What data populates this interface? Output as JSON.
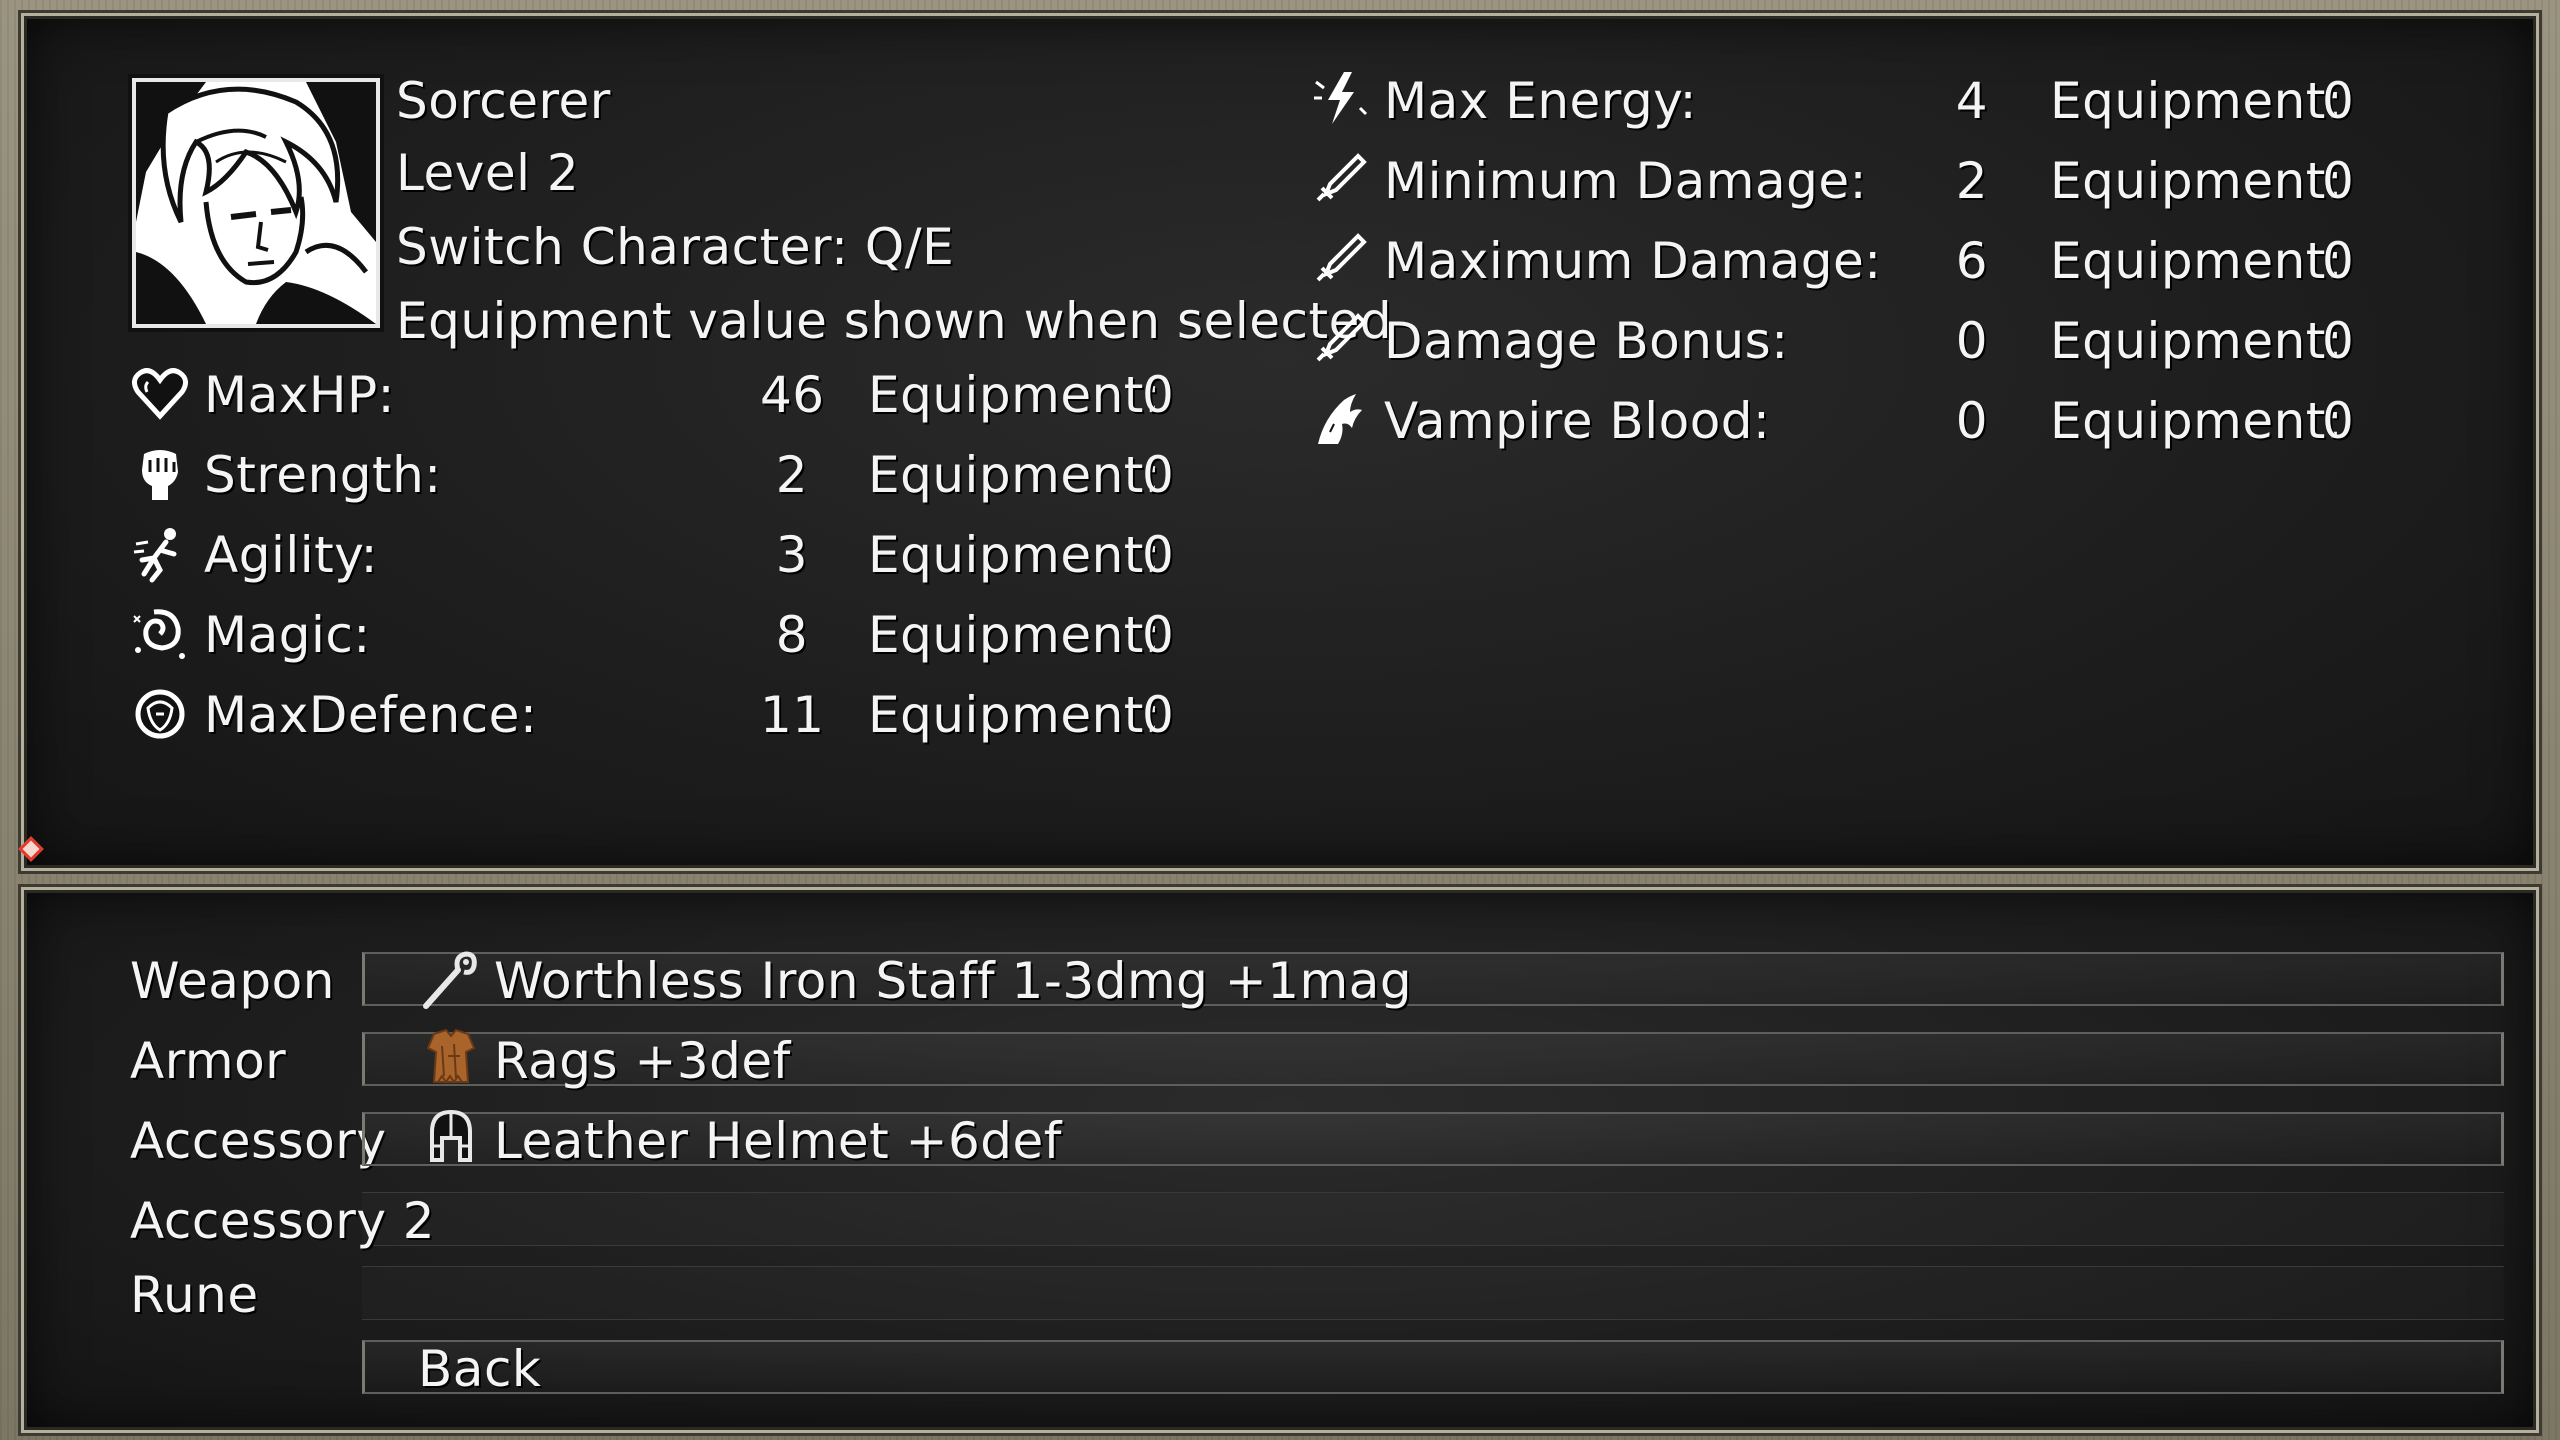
{
  "character": {
    "class_name": "Sorcerer",
    "level": "Level 2",
    "switch_hint": "Switch Character: Q/E",
    "equipment_note": "Equipment value shown when selected"
  },
  "stats_left": [
    {
      "icon": "heart-icon",
      "label": "MaxHP:",
      "value": "46",
      "equip_label": "Equipment:",
      "equip_value": "0"
    },
    {
      "icon": "fist-icon",
      "label": "Strength:",
      "value": "2",
      "equip_label": "Equipment:",
      "equip_value": "0"
    },
    {
      "icon": "running-figure-icon",
      "label": "Agility:",
      "value": "3",
      "equip_label": "Equipment:",
      "equip_value": "0"
    },
    {
      "icon": "magic-swirl-icon",
      "label": "Magic:",
      "value": "8",
      "equip_label": "Equipment:",
      "equip_value": "0"
    },
    {
      "icon": "shield-icon",
      "label": "MaxDefence:",
      "value": "11",
      "equip_label": "Equipment:",
      "equip_value": "0"
    }
  ],
  "stats_right": [
    {
      "icon": "energy-lightning-icon",
      "label": "Max Energy:",
      "value": "4",
      "equip_label": "Equipment:",
      "equip_value": "0"
    },
    {
      "icon": "sword-icon",
      "label": "Minimum Damage:",
      "value": "2",
      "equip_label": "Equipment:",
      "equip_value": "0"
    },
    {
      "icon": "sword-icon",
      "label": "Maximum Damage:",
      "value": "6",
      "equip_label": "Equipment:",
      "equip_value": "0"
    },
    {
      "icon": "sword-icon",
      "label": "Damage Bonus:",
      "value": "0",
      "equip_label": "Equipment:",
      "equip_value": "0"
    },
    {
      "icon": "vampire-claw-icon",
      "label": "Vampire Blood:",
      "value": "0",
      "equip_label": "Equipment:",
      "equip_value": "0"
    }
  ],
  "equipment_slots": [
    {
      "slot": "Weapon",
      "icon": "staff-icon",
      "item": "Worthless Iron  Staff 1-3dmg +1mag"
    },
    {
      "slot": "Armor",
      "icon": "rags-armor-icon",
      "item": "Rags +3def"
    },
    {
      "slot": "Accessory",
      "icon": "helmet-icon",
      "item": "Leather Helmet +6def"
    },
    {
      "slot": "Accessory 2",
      "icon": "",
      "item": ""
    },
    {
      "slot": "Rune",
      "icon": "",
      "item": ""
    }
  ],
  "back_label": "Back",
  "colors": {
    "panel_bg": "#1e1e1e",
    "frame": "#8a8472",
    "text": "#f4f4f4",
    "cursor": "#e23b2b"
  }
}
